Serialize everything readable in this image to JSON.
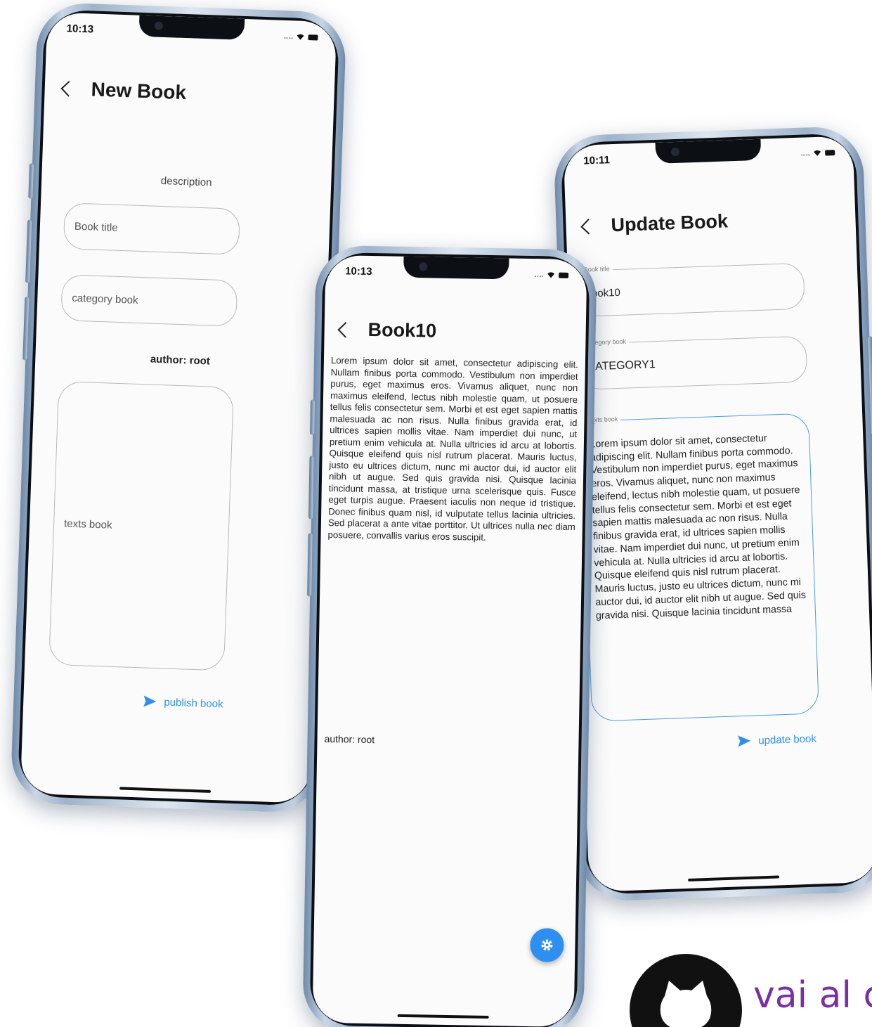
{
  "phones": {
    "new_book": {
      "status_time": "10:13",
      "title": "New Book",
      "description_label": "description",
      "book_title_placeholder": "Book title",
      "category_placeholder": "category book",
      "author_label": "author: root",
      "texts_placeholder": "texts book",
      "publish_label": "publish book"
    },
    "book_detail": {
      "status_time": "10:13",
      "title": "Book10",
      "body": "Lorem ipsum dolor sit amet, consectetur adipiscing elit. Nullam finibus porta commodo. Vestibulum non imperdiet purus, eget maximus eros. Vivamus aliquet, nunc non maximus eleifend, lectus nibh molestie quam, ut posuere tellus felis consectetur sem. Morbi et est eget sapien mattis malesuada ac non risus. Nulla finibus gravida erat, id ultrices sapien mollis vitae. Nam imperdiet dui nunc, ut pretium enim vehicula at. Nulla ultricies id arcu at lobortis. Quisque eleifend quis nisl rutrum placerat. Mauris luctus, justo eu ultrices dictum, nunc mi auctor dui, id auctor elit nibh ut augue. Sed quis gravida nisi. Quisque lacinia tincidunt massa, at tristique urna scelerisque quis. Fusce eget turpis augue. Praesent iaculis non neque id tristique. Donec finibus quam nisl, id vulputate tellus lacinia ultricies. Sed placerat a ante vitae porttitor. Ut ultrices nulla nec diam posuere, convallis varius eros suscipit.",
      "author": "author: root"
    },
    "update_book": {
      "status_time": "10:11",
      "title": "Update Book",
      "book_title_label": "Book title",
      "book_title_value": "Book10",
      "category_label": "category book",
      "category_value": "CATEGORY1",
      "texts_label": "texts book",
      "texts_value": "Lorem ipsum dolor sit amet, consectetur adipiscing elit. Nullam finibus porta commodo. Vestibulum non imperdiet purus, eget maximus eros. Vivamus aliquet, nunc non maximus eleifend, lectus nibh molestie quam, ut posuere tellus felis consectetur sem. Morbi et est eget sapien mattis malesuada ac non risus. Nulla finibus gravida erat, id ultrices sapien mollis vitae. Nam imperdiet dui nunc, ut pretium enim vehicula at. Nulla ultricies id arcu at lobortis. Quisque eleifend quis nisl rutrum placerat. Mauris luctus, justo eu ultrices dictum, nunc mi auctor dui, id auctor elit nibh ut augue. Sed quis gravida nisi. Quisque lacinia tincidunt massa",
      "update_label": "update book"
    }
  },
  "cta": {
    "text": "vai al c"
  },
  "colors": {
    "accent": "#2f8ff0",
    "cta": "#7a2fa5"
  }
}
